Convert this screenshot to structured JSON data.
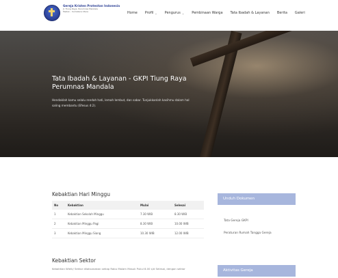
{
  "header": {
    "org_name": "Gereja Kristen Protestan Indonesia",
    "org_sub1": "Jl. Tiung Raya, Perumnas Mandala",
    "org_sub2": "Medan - Sumatera Utara",
    "logo_text": "GKPI"
  },
  "nav": {
    "items": [
      {
        "label": "Home"
      },
      {
        "label": "Profil",
        "has_dropdown": true
      },
      {
        "label": "Pengurus",
        "has_dropdown": true
      },
      {
        "label": "Pembinaan Warga"
      },
      {
        "label": "Tata Ibadah & Layanan"
      },
      {
        "label": "Berita"
      },
      {
        "label": "Galeri"
      }
    ]
  },
  "hero": {
    "title": "Tata Ibadah & Layanan - GKPI Tiung Raya Perumnas Mandala",
    "subtitle": "Hendaklah kamu selalu rendah hati, lemah lembut, dan sabar. Tunjukkanlah kasihmu dalam hal saling membantu (Efesus 4:2)."
  },
  "kebaktian_minggu": {
    "title": "Kebaktian Hari Minggu",
    "columns": [
      "No",
      "Kebaktian",
      "Mulai",
      "Selesai"
    ],
    "rows": [
      [
        "1",
        "Kebaktian Sekolah Minggu",
        "7.30 WIB",
        "8.30 WIB"
      ],
      [
        "2",
        "Kebaktian Minggu Pagi",
        "8.30 WIB",
        "10.00 WIB"
      ],
      [
        "3",
        "Kebaktian Minggu Siang",
        "10.30 WIB",
        "12.00 WIB"
      ]
    ]
  },
  "kebaktian_sektor": {
    "title": "Kebaktian Sektor",
    "text": "Kebaktian Wleik/ Sektor dilaksanakan setiap Rabu Malam Masuk Pukul 8.00 s/d Selesai, dengan sektor"
  },
  "sidebar": {
    "unduh_title": "Unduh Dokumen",
    "links": [
      "Tata Gereja GKPI",
      "Peraturan Rumah Tangga Gereja"
    ],
    "aktivitas_title": "Aktivitas Gereja"
  }
}
